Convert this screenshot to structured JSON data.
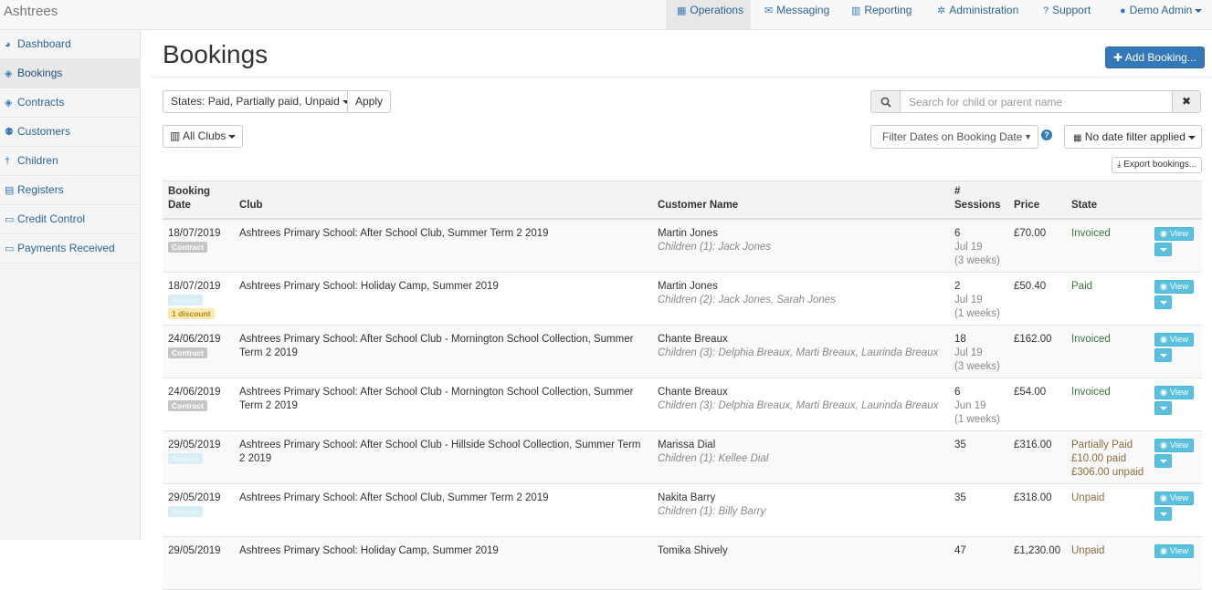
{
  "navbar": {
    "brand": "Ashtrees",
    "items": [
      {
        "label": "Operations",
        "icon": "grid-icon"
      },
      {
        "label": "Messaging",
        "icon": "envelope-icon"
      },
      {
        "label": "Reporting",
        "icon": "bar-chart-icon"
      },
      {
        "label": "Administration",
        "icon": "gear-icon"
      },
      {
        "label": "Support",
        "icon": "question-circle-icon"
      },
      {
        "label": "Demo Admin",
        "icon": "user-icon"
      }
    ]
  },
  "sidebar": {
    "items": [
      {
        "label": "Dashboard",
        "icon": "dashboard-icon"
      },
      {
        "label": "Bookings",
        "icon": "tag-icon"
      },
      {
        "label": "Contracts",
        "icon": "tag-icon"
      },
      {
        "label": "Customers",
        "icon": "users-icon"
      },
      {
        "label": "Children",
        "icon": "child-icon"
      },
      {
        "label": "Registers",
        "icon": "list-icon"
      },
      {
        "label": "Credit Control",
        "icon": "money-icon"
      },
      {
        "label": "Payments Received",
        "icon": "money-icon"
      }
    ]
  },
  "page": {
    "title": "Bookings",
    "add_button": "Add Booking...",
    "states_filter": "States: Paid, Partially paid, Unpaid",
    "apply_button": "Apply",
    "clubs_filter": "All Clubs",
    "search_placeholder": "Search for child or parent name",
    "clear_search": "✖",
    "date_filter_type": "Filter Dates on Booking Date",
    "date_filter": "No date filter applied",
    "export_button": "Export bookings..."
  },
  "table": {
    "headers": {
      "booking_date": [
        "Booking",
        "Date"
      ],
      "club": "Club",
      "customer": "Customer Name",
      "sessions": [
        "#",
        "Sessions"
      ],
      "price": "Price",
      "state": "State"
    },
    "view_label": "View",
    "rows": [
      {
        "date": "18/07/2019",
        "badges": [
          "Contract"
        ],
        "club": "Ashtrees Primary School: After School Club, Summer Term 2 2019",
        "customer": "Martin Jones",
        "children": "Children (1): Jack Jones",
        "sessions": "6",
        "month": "Jul 19",
        "weeks": "(3 weeks)",
        "price": "£70.00",
        "state": "Invoiced",
        "state_lines": []
      },
      {
        "date": "18/07/2019",
        "badges": [
          "Ad-Hoc",
          "1 discount"
        ],
        "club": "Ashtrees Primary School: Holiday Camp, Summer 2019",
        "customer": "Martin Jones",
        "children": "Children (2): Jack Jones, Sarah Jones",
        "sessions": "2",
        "month": "Jul 19",
        "weeks": "(1 weeks)",
        "price": "£50.40",
        "state": "Paid",
        "state_lines": []
      },
      {
        "date": "24/06/2019",
        "badges": [
          "Contract"
        ],
        "club": "Ashtrees Primary School: After School Club - Mornington School Collection, Summer Term 2 2019",
        "customer": "Chante Breaux",
        "children": "Children (3): Delphia Breaux, Marti Breaux, Laurinda Breaux",
        "sessions": "18",
        "month": "Jul 19",
        "weeks": "(3 weeks)",
        "price": "£162.00",
        "state": "Invoiced",
        "state_lines": []
      },
      {
        "date": "24/06/2019",
        "badges": [
          "Contract"
        ],
        "club": "Ashtrees Primary School: After School Club - Mornington School Collection, Summer Term 2 2019",
        "customer": "Chante Breaux",
        "children": "Children (3): Delphia Breaux, Marti Breaux, Laurinda Breaux",
        "sessions": "6",
        "month": "Jun 19",
        "weeks": "(1 weeks)",
        "price": "£54.00",
        "state": "Invoiced",
        "state_lines": []
      },
      {
        "date": "29/05/2019",
        "badges": [
          "Ad-Hoc"
        ],
        "club": "Ashtrees Primary School: After School Club - Hillside School Collection, Summer Term 2 2019",
        "customer": "Marissa Dial",
        "children": "Children (1): Kellee Dial",
        "sessions": "35",
        "month": "",
        "weeks": "",
        "price": "£316.00",
        "state": "Partially Paid",
        "state_lines": [
          "£10.00 paid",
          "£306.00 unpaid"
        ]
      },
      {
        "date": "29/05/2019",
        "badges": [
          "Ad-Hoc"
        ],
        "club": "Ashtrees Primary School: After School Club, Summer Term 2 2019",
        "customer": "Nakita Barry",
        "children": "Children (1): Billy Barry",
        "sessions": "35",
        "month": "",
        "weeks": "",
        "price": "£318.00",
        "state": "Unpaid",
        "state_lines": []
      },
      {
        "date": "29/05/2019",
        "badges": [],
        "club": "Ashtrees Primary School: Holiday Camp, Summer 2019",
        "customer": "Tomika Shively",
        "children": "",
        "sessions": "47",
        "month": "",
        "weeks": "",
        "price": "£1,230.00",
        "state": "Unpaid",
        "state_lines": []
      }
    ]
  }
}
